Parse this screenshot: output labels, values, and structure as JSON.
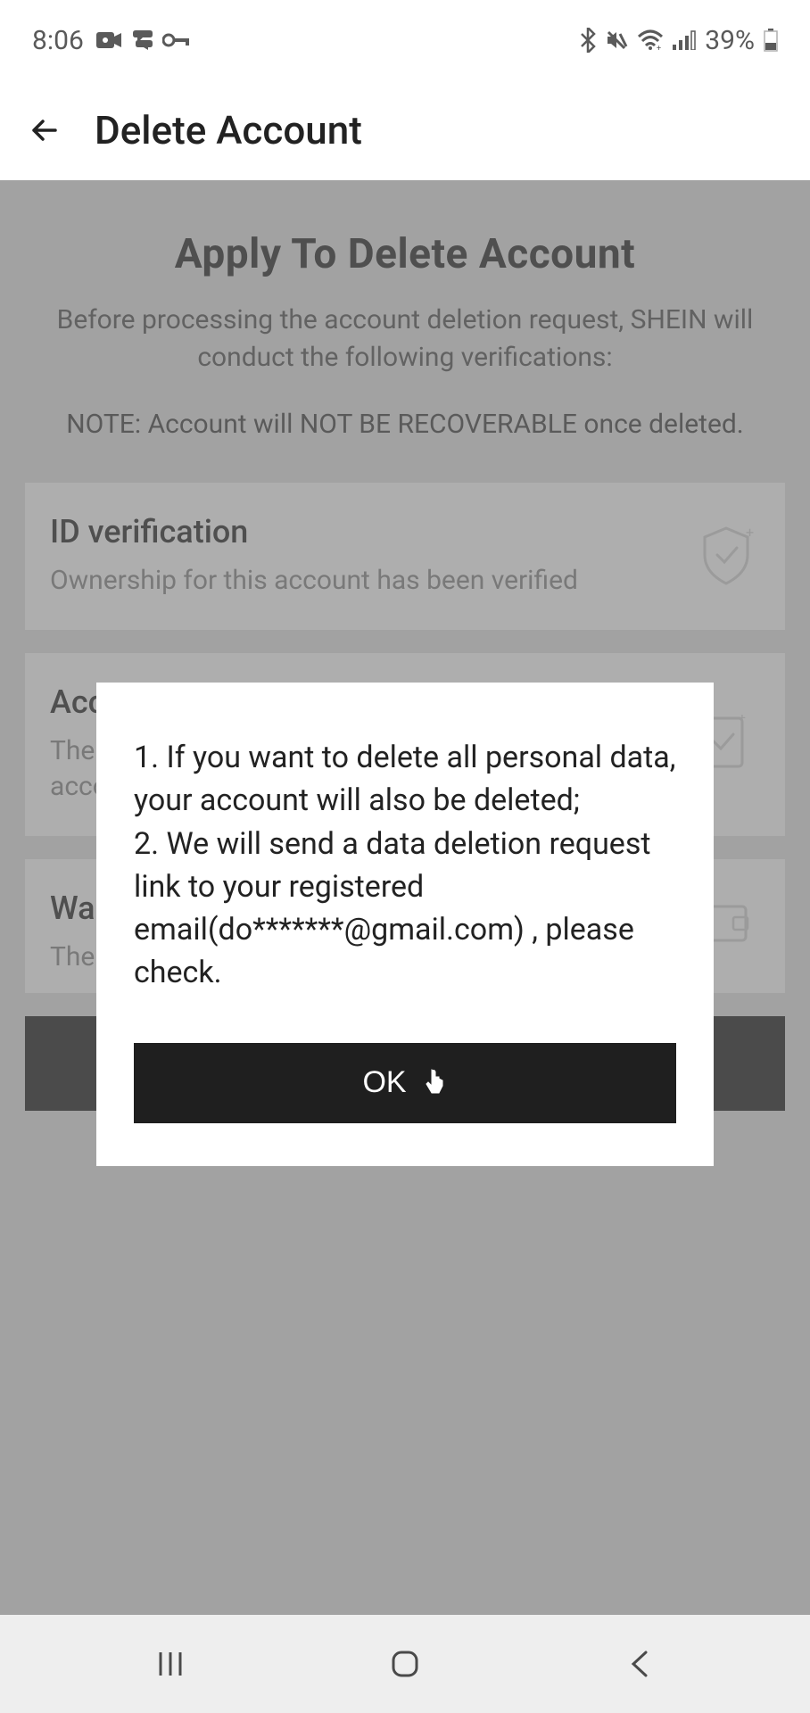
{
  "status": {
    "time": "8:06",
    "battery": "39%"
  },
  "header": {
    "title": "Delete Account"
  },
  "main": {
    "heading": "Apply To Delete Account",
    "subheading": "Before processing the account deletion request, SHEIN will conduct the following verifications:",
    "note": "NOTE: Account will NOT BE RECOVERABLE once deleted.",
    "cards": [
      {
        "title": "ID verification",
        "desc": "Ownership for this account has been verified"
      },
      {
        "title": "Account order complete",
        "desc": "There are no pending orders or returns for this account"
      },
      {
        "title": "Wa",
        "desc": "The"
      }
    ]
  },
  "modal": {
    "line1": "1. If you want to delete all personal data, your account will also be deleted;",
    "line2": "2. We will send a data deletion request link to your registered email(do*******@gmail.com) , please check.",
    "button": "OK"
  }
}
